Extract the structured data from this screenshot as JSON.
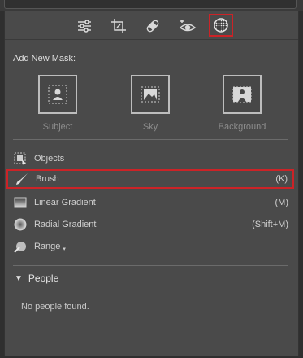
{
  "toolbar": {
    "tools": [
      {
        "name": "edit-sliders",
        "icon": "sliders-icon",
        "active": false
      },
      {
        "name": "crop",
        "icon": "crop-icon",
        "active": false
      },
      {
        "name": "healing",
        "icon": "bandage-icon",
        "active": false
      },
      {
        "name": "red-eye",
        "icon": "eye-icon",
        "active": false
      },
      {
        "name": "masking",
        "icon": "mask-circle-icon",
        "active": true
      }
    ],
    "highlight_color": "#cc2327"
  },
  "masking": {
    "add_new_label": "Add New Mask:",
    "quick_masks": [
      {
        "label": "Subject",
        "icon": "person-icon"
      },
      {
        "label": "Sky",
        "icon": "landscape-icon"
      },
      {
        "label": "Background",
        "icon": "person-background-icon"
      }
    ],
    "tools": [
      {
        "label": "Objects",
        "shortcut": "",
        "icon": "objects-icon"
      },
      {
        "label": "Brush",
        "shortcut": "(K)",
        "icon": "brush-icon",
        "highlighted": true
      },
      {
        "label": "Linear Gradient",
        "shortcut": "(M)",
        "icon": "linear-gradient-icon"
      },
      {
        "label": "Radial Gradient",
        "shortcut": "(Shift+M)",
        "icon": "radial-gradient-icon"
      },
      {
        "label": "Range",
        "shortcut": "",
        "icon": "range-icon"
      }
    ]
  },
  "people": {
    "title": "People",
    "empty_text": "No people found."
  }
}
